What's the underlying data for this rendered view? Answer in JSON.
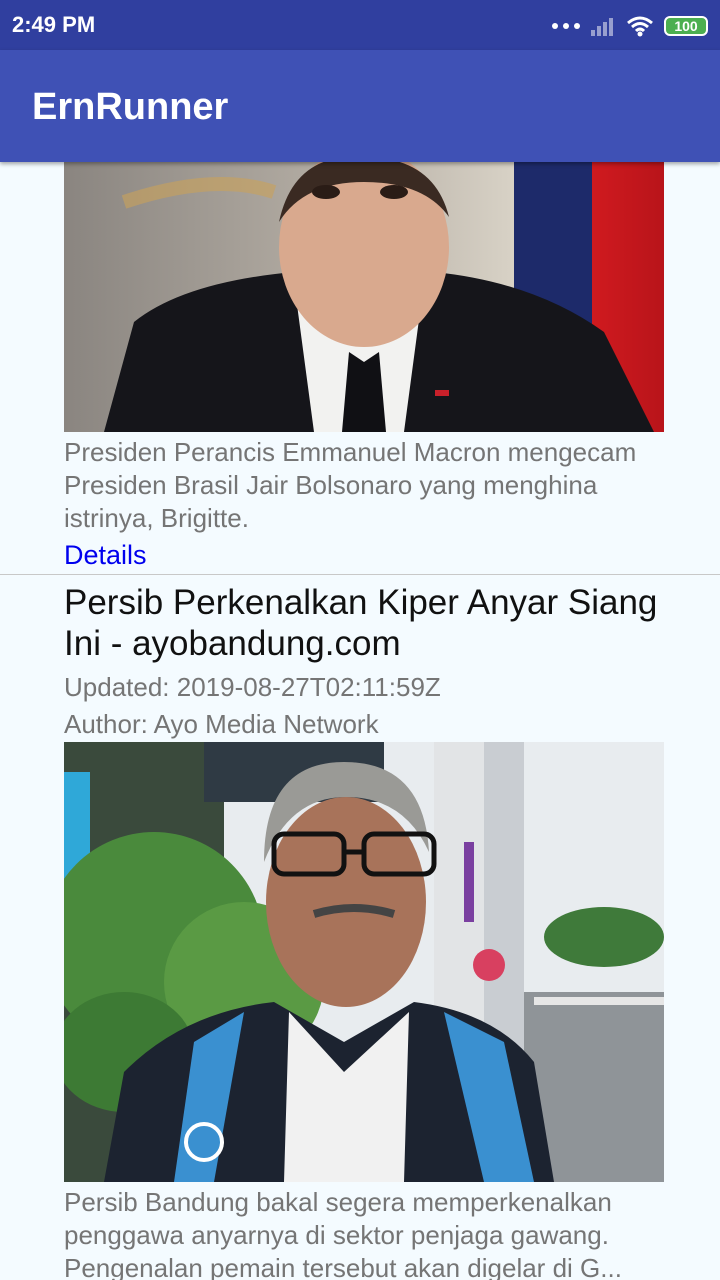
{
  "status_bar": {
    "time": "2:49 PM",
    "battery": "100"
  },
  "app_bar": {
    "title": "ErnRunner"
  },
  "articles": [
    {
      "image_description": "Portrait photo of man in dark suit",
      "description": "Presiden Perancis Emmanuel Macron mengecam Presiden Brasil Jair Bolsonaro yang menghina istrinya, Brigitte.",
      "details_label": "Details"
    },
    {
      "title": "Persib Perkenalkan Kiper Anyar Siang Ini - ayobandung.com",
      "updated": "Updated: 2019-08-27T02:11:59Z",
      "author": "Author: Ayo Media Network",
      "description": "Persib Bandung bakal segera memperkenalkan penggawa anyarnya di sektor penjaga gawang. Pengenalan pemain tersebut akan digelar di G..."
    }
  ],
  "colors": {
    "status_bar": "#303f9f",
    "app_bar": "#3f51b5",
    "background": "#f4fbff",
    "link": "#0000ee"
  }
}
